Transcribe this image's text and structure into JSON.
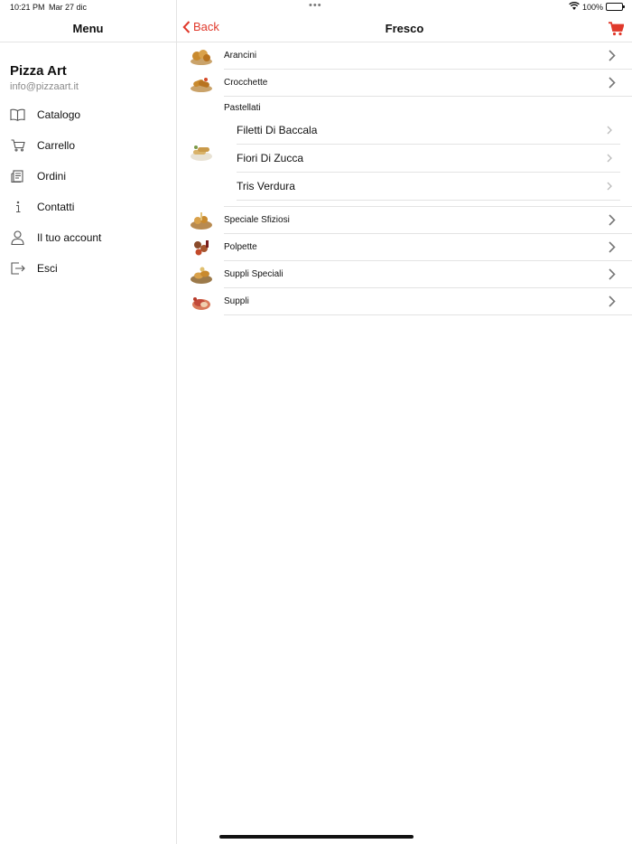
{
  "status": {
    "time": "10:21 PM",
    "date": "Mar 27 dic",
    "dots": "•••",
    "battery": "100%"
  },
  "sidebar": {
    "title": "Menu",
    "profile": {
      "name": "Pizza Art",
      "email": "info@pizzaart.it"
    },
    "items": [
      {
        "label": "Catalogo",
        "icon": "book-icon"
      },
      {
        "label": "Carrello",
        "icon": "cart-icon"
      },
      {
        "label": "Ordini",
        "icon": "receipt-icon"
      },
      {
        "label": "Contatti",
        "icon": "info-icon"
      },
      {
        "label": "Il tuo account",
        "icon": "person-icon"
      },
      {
        "label": "Esci",
        "icon": "logout-icon"
      }
    ]
  },
  "nav": {
    "back_label": "Back",
    "title": "Fresco"
  },
  "list": {
    "top_items": [
      {
        "label": "Arancini"
      },
      {
        "label": "Crocchette"
      }
    ],
    "group": {
      "title": "Pastellati",
      "items": [
        {
          "label": "Filetti Di Baccala"
        },
        {
          "label": "Fiori Di Zucca"
        },
        {
          "label": "Tris Verdura"
        }
      ]
    },
    "bottom_items": [
      {
        "label": "Speciale Sfiziosi"
      },
      {
        "label": "Polpette"
      },
      {
        "label": "Suppli Speciali"
      },
      {
        "label": "Suppli"
      }
    ]
  },
  "colors": {
    "accent": "#e0392b",
    "separator": "#e3e3e3",
    "muted": "#8a8a8a"
  }
}
